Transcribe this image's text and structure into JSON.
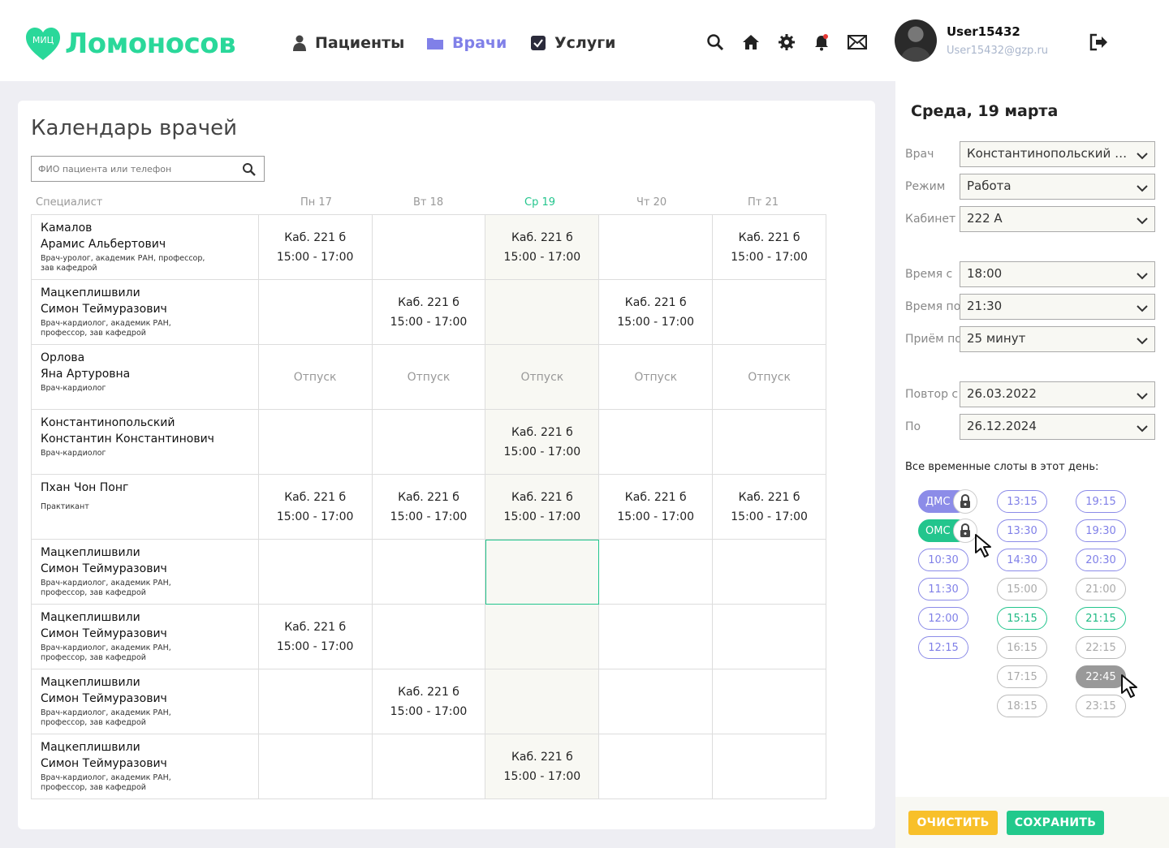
{
  "brand": {
    "name": "Ломоносов",
    "badge": "МИЦ"
  },
  "nav": {
    "patients": "Пациенты",
    "doctors": "Врачи",
    "services": "Услуги"
  },
  "user": {
    "name": "User15432",
    "email": "User15432@gzp.ru"
  },
  "page": {
    "title": "Календарь врачей",
    "search_placeholder": "ФИО пациента или телефон"
  },
  "columns": {
    "specialist": "Специалист",
    "days": [
      "Пн 17",
      "Вт 18",
      "Ср 19",
      "Чт 20",
      "Пт 21"
    ]
  },
  "slot_text": {
    "room": "Каб. 221 б",
    "time": "15:00 - 17:00",
    "vacation": "Отпуск"
  },
  "doctors": [
    {
      "last": "Камалов",
      "first": "Арамис Альбертович",
      "role": "Врач-уролог, академик РАН, профессор, зав кафедрой"
    },
    {
      "last": "Мацкеплишвили",
      "first": "Симон Теймуразович",
      "role": "Врач-кардиолог, академик РАН, профессор, зав кафедрой"
    },
    {
      "last": "Орлова",
      "first": "Яна Артуровна",
      "role": "Врач-кардиолог"
    },
    {
      "last": "Константинопольский",
      "first": "Константин Константинович",
      "role": "Врач-кардиолог"
    },
    {
      "last": "Пхан Чон Понг",
      "first": "",
      "role": "Практикант"
    },
    {
      "last": "Мацкеплишвили",
      "first": "Симон Теймуразович",
      "role": "Врач-кардиолог, академик РАН, профессор, зав кафедрой"
    },
    {
      "last": "Мацкеплишвили",
      "first": "Симон Теймуразович",
      "role": "Врач-кардиолог, академик РАН, профессор, зав кафедрой"
    },
    {
      "last": "Мацкеплишвили",
      "first": "Симон Теймуразович",
      "role": "Врач-кардиолог, академик РАН, профессор, зав кафедрой"
    },
    {
      "last": "Мацкеплишвили",
      "first": "Симон Теймуразович",
      "role": "Врач-кардиолог, академик РАН, профессор, зав кафедрой"
    }
  ],
  "schedule": [
    [
      "slot",
      "",
      "slot",
      "",
      "slot"
    ],
    [
      "",
      "slot",
      "",
      "slot",
      ""
    ],
    [
      "vac",
      "vac",
      "vac",
      "vac",
      "vac"
    ],
    [
      "",
      "",
      "slot",
      "",
      ""
    ],
    [
      "slot",
      "slot",
      "slot",
      "slot",
      "slot"
    ],
    [
      "",
      "",
      "",
      "",
      ""
    ],
    [
      "slot",
      "",
      "",
      "",
      ""
    ],
    [
      "",
      "slot",
      "",
      "",
      ""
    ],
    [
      "",
      "",
      "slot",
      "",
      ""
    ]
  ],
  "panel": {
    "date": "Среда, 19 марта",
    "labels": {
      "doctor": "Врач",
      "mode": "Режим",
      "room": "Кабинет",
      "time_from": "Время с",
      "time_to": "Время по",
      "appointment": "Приём по",
      "repeat_from": "Повтор с",
      "until": "По"
    },
    "values": {
      "doctor": "Константинопольский Константин Константинович",
      "mode": "Работа",
      "room": "222 А",
      "time_from": "18:00",
      "time_to": "21:30",
      "appointment": "25 минут",
      "repeat_from": "26.03.2022",
      "until": "26.12.2024"
    },
    "slots_label": "Все временные слоты в этот день:",
    "slots": {
      "col1": [
        "ДМС",
        "ОМС",
        "10:30",
        "11:30",
        "12:00",
        "12:15"
      ],
      "col2": [
        "13:15",
        "13:30",
        "14:30",
        "15:00",
        "15:15",
        "16:15",
        "17:15",
        "18:15"
      ],
      "col3": [
        "19:15",
        "19:30",
        "20:30",
        "21:00",
        "21:15",
        "22:15",
        "22:45",
        "23:15"
      ]
    },
    "buttons": {
      "clear": "ОЧИСТИТЬ",
      "save": "СОХРАНИТЬ"
    }
  },
  "colors": {
    "brand_green": "#2ad89a",
    "accent_purple": "#8080e8",
    "yellow": "#f8c02a"
  }
}
